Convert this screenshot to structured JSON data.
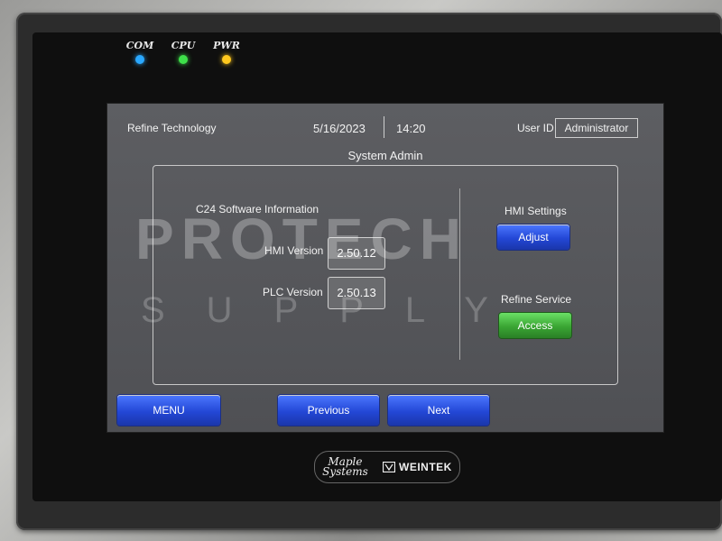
{
  "leds": [
    {
      "label": "COM",
      "color": "#2aa8ff"
    },
    {
      "label": "CPU",
      "color": "#3ee04a"
    },
    {
      "label": "PWR",
      "color": "#ffc81e"
    }
  ],
  "header": {
    "company": "Refine Technology",
    "date": "5/16/2023",
    "time": "14:20",
    "user_label": "User ID",
    "user_value": "Administrator"
  },
  "page_title": "System Admin",
  "software_info": {
    "heading": "C24 Software Information",
    "hmi_label": "HMI Version",
    "hmi_value": "2.50.12",
    "plc_label": "PLC Version",
    "plc_value": "2.50.13"
  },
  "hmi_settings": {
    "heading": "HMI Settings",
    "button": "Adjust"
  },
  "refine_service": {
    "heading": "Refine Service",
    "button": "Access"
  },
  "nav": {
    "menu": "MENU",
    "previous": "Previous",
    "next": "Next"
  },
  "brand": {
    "maple_line1": "Maple",
    "maple_line2": "Systems",
    "weintek": "WEINTEK"
  },
  "watermark": {
    "line1": "PROTECH",
    "line2": "SUPPLY"
  }
}
